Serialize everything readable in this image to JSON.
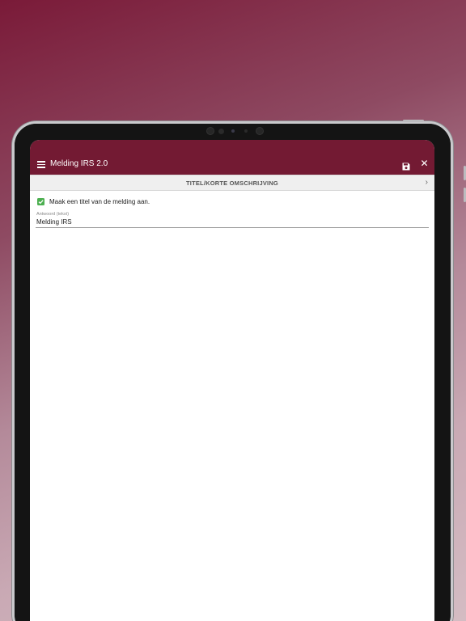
{
  "app": {
    "title": "Melding IRS 2.0",
    "accent_color": "#731a33",
    "icons": {
      "menu": "hamburger-menu-icon",
      "save": "save-icon",
      "close": "close-icon"
    }
  },
  "section": {
    "title": "TITEL/KORTE OMSCHRIJVING",
    "nav_icon": "chevron-right-icon"
  },
  "form": {
    "checkbox_label": "Maak een titel van de melding aan.",
    "checkbox_checked": true,
    "checkbox_color": "#4caf50",
    "field_label": "Antwoord (tekst)",
    "field_value": "Melding IRS"
  }
}
